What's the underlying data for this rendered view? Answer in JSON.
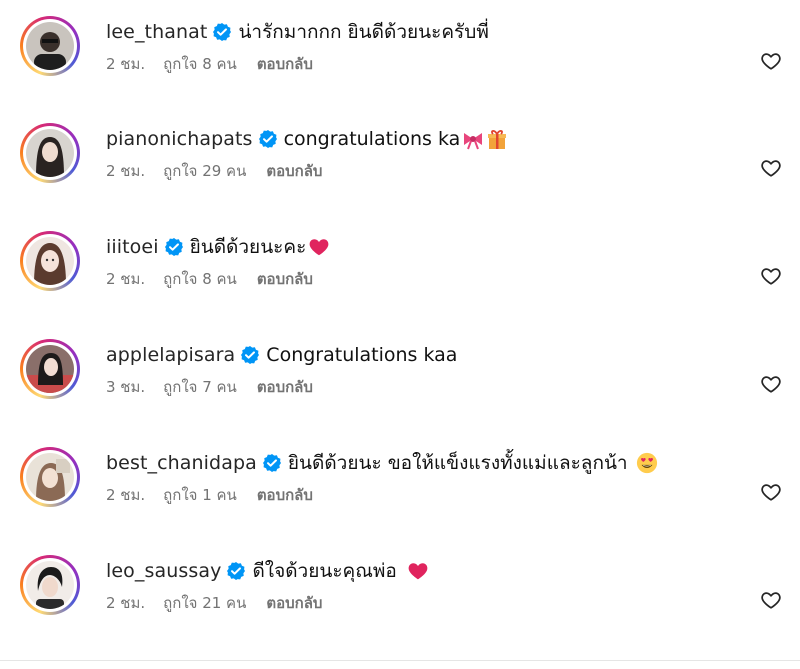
{
  "comments": [
    {
      "username": "lee_thanat",
      "text": "น่ารักมากกก ยินดีด้วยนะครับพี่",
      "emoji": "",
      "time": "2 ชม.",
      "likes": "ถูกใจ 8 คน",
      "reply": "ตอบกลับ"
    },
    {
      "username": "pianonichapats",
      "text": "congratulations ka",
      "emoji": "ribbon gift",
      "time": "2 ชม.",
      "likes": "ถูกใจ 29 คน",
      "reply": "ตอบกลับ"
    },
    {
      "username": "iiitoei",
      "text": "ยินดีด้วยนะคะ",
      "emoji": "red-heart",
      "time": "2 ชม.",
      "likes": "ถูกใจ 8 คน",
      "reply": "ตอบกลับ"
    },
    {
      "username": "applelapisara",
      "text": "Congratulations kaa",
      "emoji": "",
      "time": "3 ชม.",
      "likes": "ถูกใจ 7 คน",
      "reply": "ตอบกลับ"
    },
    {
      "username": "best_chanidapa",
      "text": "ยินดีด้วยนะ ขอให้แข็งแรงทั้งแม่และลูกน้า",
      "emoji": "heart-eyes",
      "time": "2 ชม.",
      "likes": "ถูกใจ 1 คน",
      "reply": "ตอบกลับ"
    },
    {
      "username": "leo_saussay",
      "text": "ดีใจด้วยนะคุณพ่อ",
      "emoji": "red-heart",
      "time": "2 ชม.",
      "likes": "ถูกใจ 21 คน",
      "reply": "ตอบกลับ"
    }
  ],
  "icons": {
    "verified": "verified-badge-icon",
    "like": "heart-outline-icon"
  },
  "colors": {
    "verified": "#0095f6",
    "meta_text": "#737373",
    "heart_emoji": "#e0245e"
  }
}
